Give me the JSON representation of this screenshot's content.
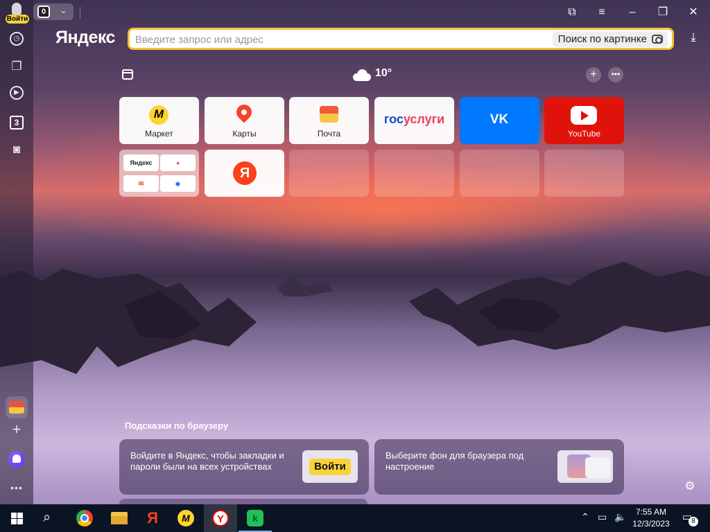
{
  "browser": {
    "login_badge": "Войти",
    "tab_count": "0",
    "brand": "Яндекс",
    "search": {
      "placeholder": "Введите запрос или адрес",
      "image_search_label": "Поиск по картинке"
    }
  },
  "dashboard": {
    "weather_temp": "10°",
    "tiles": [
      {
        "label": "Маркет"
      },
      {
        "label": "Карты"
      },
      {
        "label": "Почта"
      },
      {
        "label": "госуслуги"
      },
      {
        "label": "VK"
      },
      {
        "label": "YouTube"
      }
    ],
    "group_tile_text": "Яндекс"
  },
  "tips": {
    "title": "Подсказки по браузеру",
    "card1_text": "Войдите в Яндекс, чтобы закладки и пароли были на всех устройствах",
    "card1_button": "Войти",
    "card2_text": "Выберите фон для браузера под настроение"
  },
  "taskbar": {
    "time": "7:55 AM",
    "date": "12/3/2023",
    "notifications": "8"
  },
  "colors": {
    "accent_yellow": "#f7c23a",
    "vk_blue": "#0077ff",
    "youtube_red": "#e0130c",
    "yandex_red": "#fc3f1d"
  }
}
